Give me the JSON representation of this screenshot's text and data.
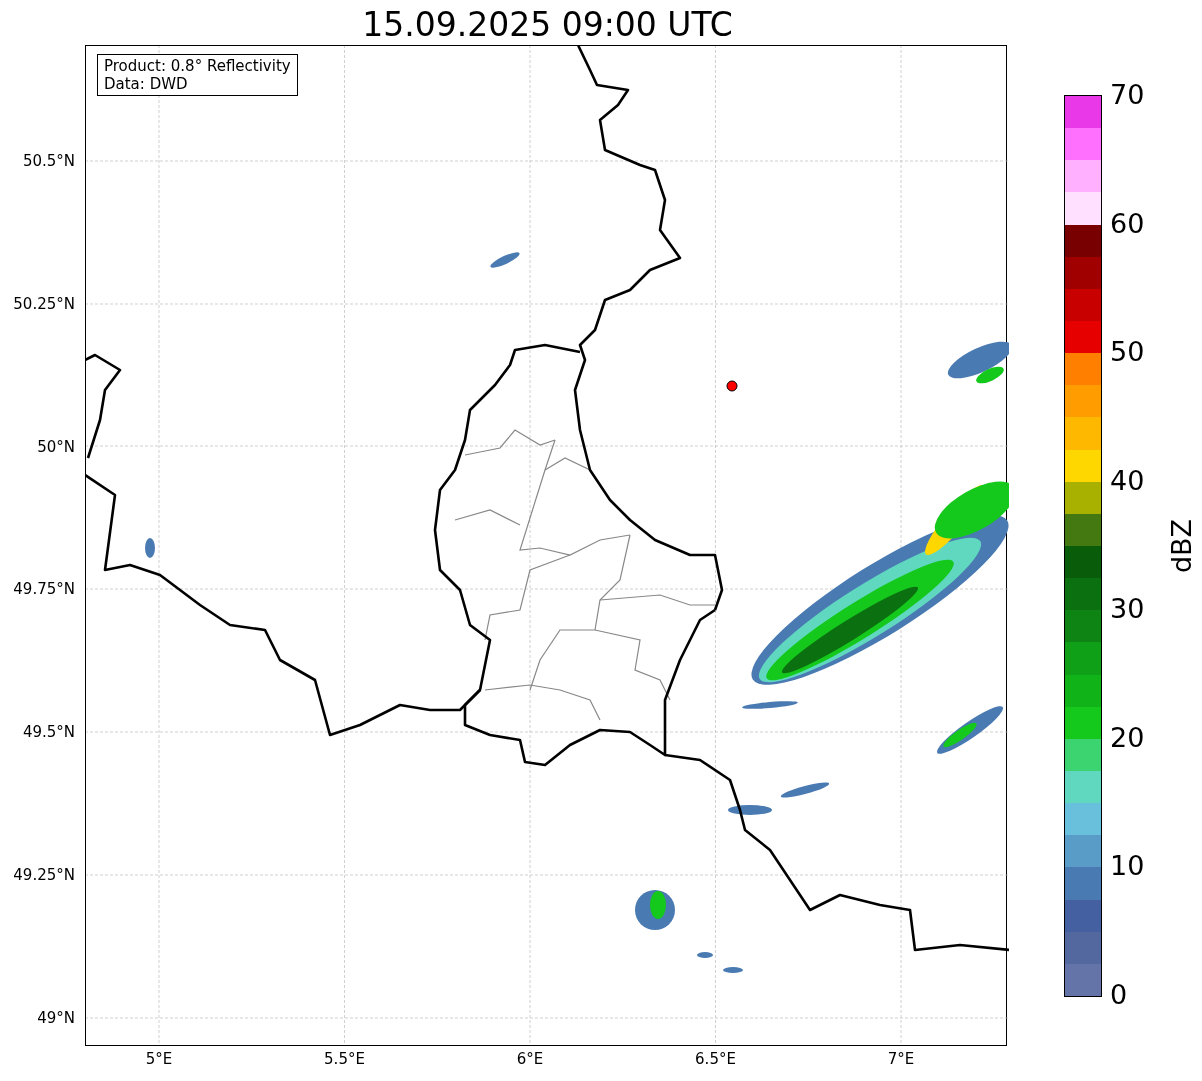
{
  "title": "15.09.2025 09:00 UTC",
  "info_box": {
    "lines": [
      "Product: 0.8° Reflectivity",
      "Data: DWD"
    ]
  },
  "x_ticks": [
    "5°E",
    "5.5°E",
    "6°E",
    "6.5°E",
    "7°E"
  ],
  "y_ticks": [
    "50.5°N",
    "50.25°N",
    "50°N",
    "49.75°N",
    "49.5°N",
    "49.25°N",
    "49°N"
  ],
  "colorbar": {
    "label": "dBZ",
    "ticks": [
      "70",
      "60",
      "50",
      "40",
      "30",
      "20",
      "10",
      "0"
    ],
    "segments": [
      {
        "color": "#e838e8"
      },
      {
        "color": "#ff70ff"
      },
      {
        "color": "#ffb0ff"
      },
      {
        "color": "#ffe0ff"
      },
      {
        "color": "#780000"
      },
      {
        "color": "#a00000"
      },
      {
        "color": "#c80000"
      },
      {
        "color": "#e60000"
      },
      {
        "color": "#ff8000"
      },
      {
        "color": "#ff9c00"
      },
      {
        "color": "#ffb800"
      },
      {
        "color": "#ffd700"
      },
      {
        "color": "#a8b000"
      },
      {
        "color": "#447810"
      },
      {
        "color": "#085c0a"
      },
      {
        "color": "#0a7010"
      },
      {
        "color": "#0e8414"
      },
      {
        "color": "#10a018"
      },
      {
        "color": "#10b418"
      },
      {
        "color": "#14c81c"
      },
      {
        "color": "#3cd470"
      },
      {
        "color": "#60d8c0"
      },
      {
        "color": "#68c0dc"
      },
      {
        "color": "#5a9cc8"
      },
      {
        "color": "#4a7ab2"
      },
      {
        "color": "#4460a0"
      },
      {
        "color": "#5468a0"
      },
      {
        "color": "#6474a8"
      }
    ]
  }
}
